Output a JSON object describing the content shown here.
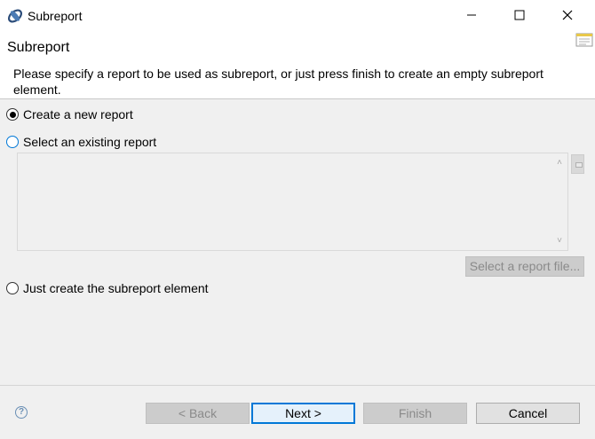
{
  "window": {
    "title": "Subreport",
    "icons": {
      "app": "eclipse-icon",
      "minimize": "minimize-icon",
      "maximize": "maximize-icon",
      "close": "close-icon"
    }
  },
  "header": {
    "title": "Subreport",
    "description": "Please specify a report to be used as subreport, or just press finish to create an empty subreport element.",
    "icon": "wizard-banner-icon"
  },
  "options": [
    {
      "label": "Create a new report",
      "checked": true
    },
    {
      "label": "Select an existing report",
      "checked": false,
      "focused": true
    },
    {
      "label": "Just create the subreport element",
      "checked": false
    }
  ],
  "existing_report": {
    "list_items": [],
    "select_file_label": "Select a report file..."
  },
  "footer": {
    "help_icon": "help-icon",
    "back_label": "< Back",
    "next_label": "Next >",
    "finish_label": "Finish",
    "cancel_label": "Cancel"
  },
  "colors": {
    "focus_accent": "#0078d7",
    "disabled_button": "#cccccc"
  }
}
